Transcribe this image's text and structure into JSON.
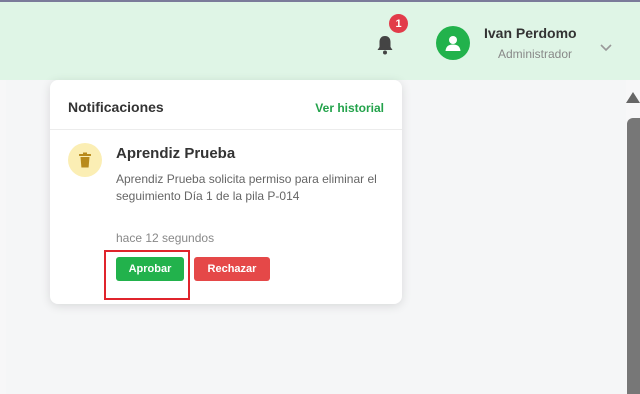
{
  "header": {
    "notification_count": "1",
    "user_name": "Ivan Perdomo",
    "user_role": "Administrador"
  },
  "notifications": {
    "title": "Notificaciones",
    "history_link": "Ver historial",
    "item": {
      "sender": "Aprendiz Prueba",
      "message": "Aprendiz Prueba solicita permiso para eliminar el seguimiento Día 1 de la pila P-014",
      "time": "hace 12 segundos",
      "approve_label": "Aprobar",
      "reject_label": "Rechazar"
    }
  },
  "colors": {
    "header_bg": "#dff5e6",
    "accent_green": "#22b24c",
    "danger_red": "#e54848",
    "badge_red": "#e23b4a"
  },
  "icons": {
    "bell": "bell-icon",
    "avatar": "user-icon",
    "chevron": "chevron-down-icon",
    "item": "trash-icon"
  }
}
